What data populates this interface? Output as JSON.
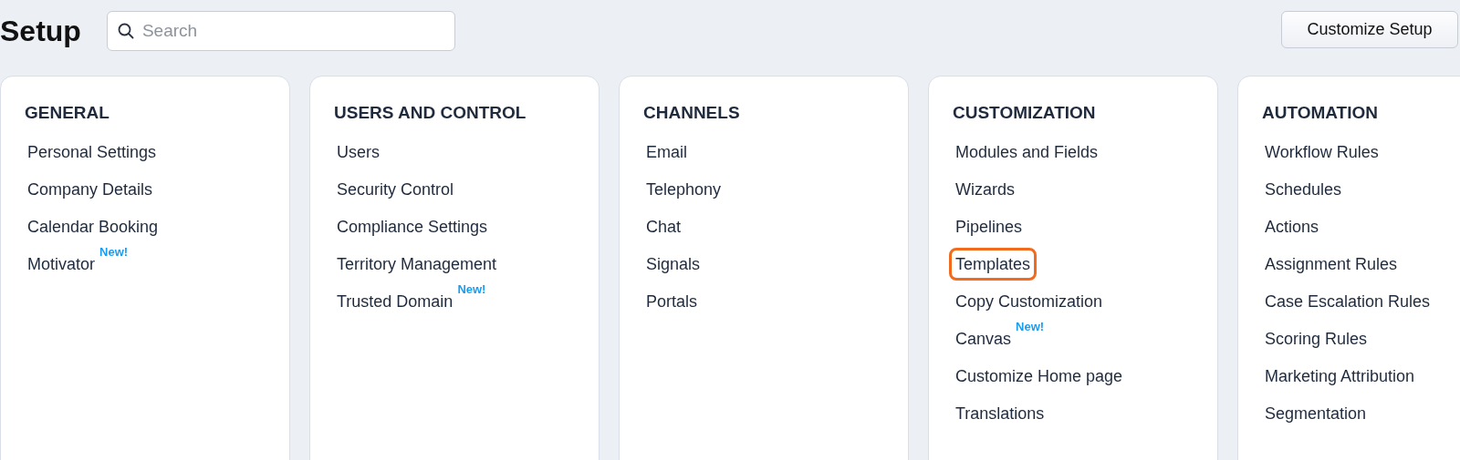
{
  "header": {
    "title": "Setup",
    "search": {
      "placeholder": "Search"
    },
    "button": "Customize Setup"
  },
  "sections": [
    {
      "title": "GENERAL",
      "items": [
        {
          "label": "Personal Settings",
          "highlighted": false
        },
        {
          "label": "Company Details",
          "highlighted": false
        },
        {
          "label": "Calendar Booking",
          "highlighted": false
        },
        {
          "label": "Motivator",
          "badge": "New!",
          "highlighted": false
        }
      ]
    },
    {
      "title": "USERS AND CONTROL",
      "items": [
        {
          "label": "Users",
          "highlighted": false
        },
        {
          "label": "Security Control",
          "highlighted": false
        },
        {
          "label": "Compliance Settings",
          "highlighted": false
        },
        {
          "label": "Territory Management",
          "highlighted": false
        },
        {
          "label": "Trusted Domain",
          "badge": "New!",
          "highlighted": false
        }
      ]
    },
    {
      "title": "CHANNELS",
      "items": [
        {
          "label": "Email",
          "highlighted": false
        },
        {
          "label": "Telephony",
          "highlighted": false
        },
        {
          "label": "Chat",
          "highlighted": false
        },
        {
          "label": "Signals",
          "highlighted": false
        },
        {
          "label": "Portals",
          "highlighted": false
        }
      ]
    },
    {
      "title": "CUSTOMIZATION",
      "items": [
        {
          "label": "Modules and Fields",
          "highlighted": false
        },
        {
          "label": "Wizards",
          "highlighted": false
        },
        {
          "label": "Pipelines",
          "highlighted": false
        },
        {
          "label": "Templates",
          "highlighted": true
        },
        {
          "label": "Copy Customization",
          "highlighted": false
        },
        {
          "label": "Canvas",
          "badge": "New!",
          "highlighted": false
        },
        {
          "label": "Customize Home page",
          "highlighted": false
        },
        {
          "label": "Translations",
          "highlighted": false
        }
      ]
    },
    {
      "title": "AUTOMATION",
      "items": [
        {
          "label": "Workflow Rules",
          "highlighted": false
        },
        {
          "label": "Schedules",
          "highlighted": false
        },
        {
          "label": "Actions",
          "highlighted": false
        },
        {
          "label": "Assignment Rules",
          "highlighted": false
        },
        {
          "label": "Case Escalation Rules",
          "highlighted": false
        },
        {
          "label": "Scoring Rules",
          "highlighted": false
        },
        {
          "label": "Marketing Attribution",
          "highlighted": false
        },
        {
          "label": "Segmentation",
          "highlighted": false
        }
      ]
    }
  ]
}
